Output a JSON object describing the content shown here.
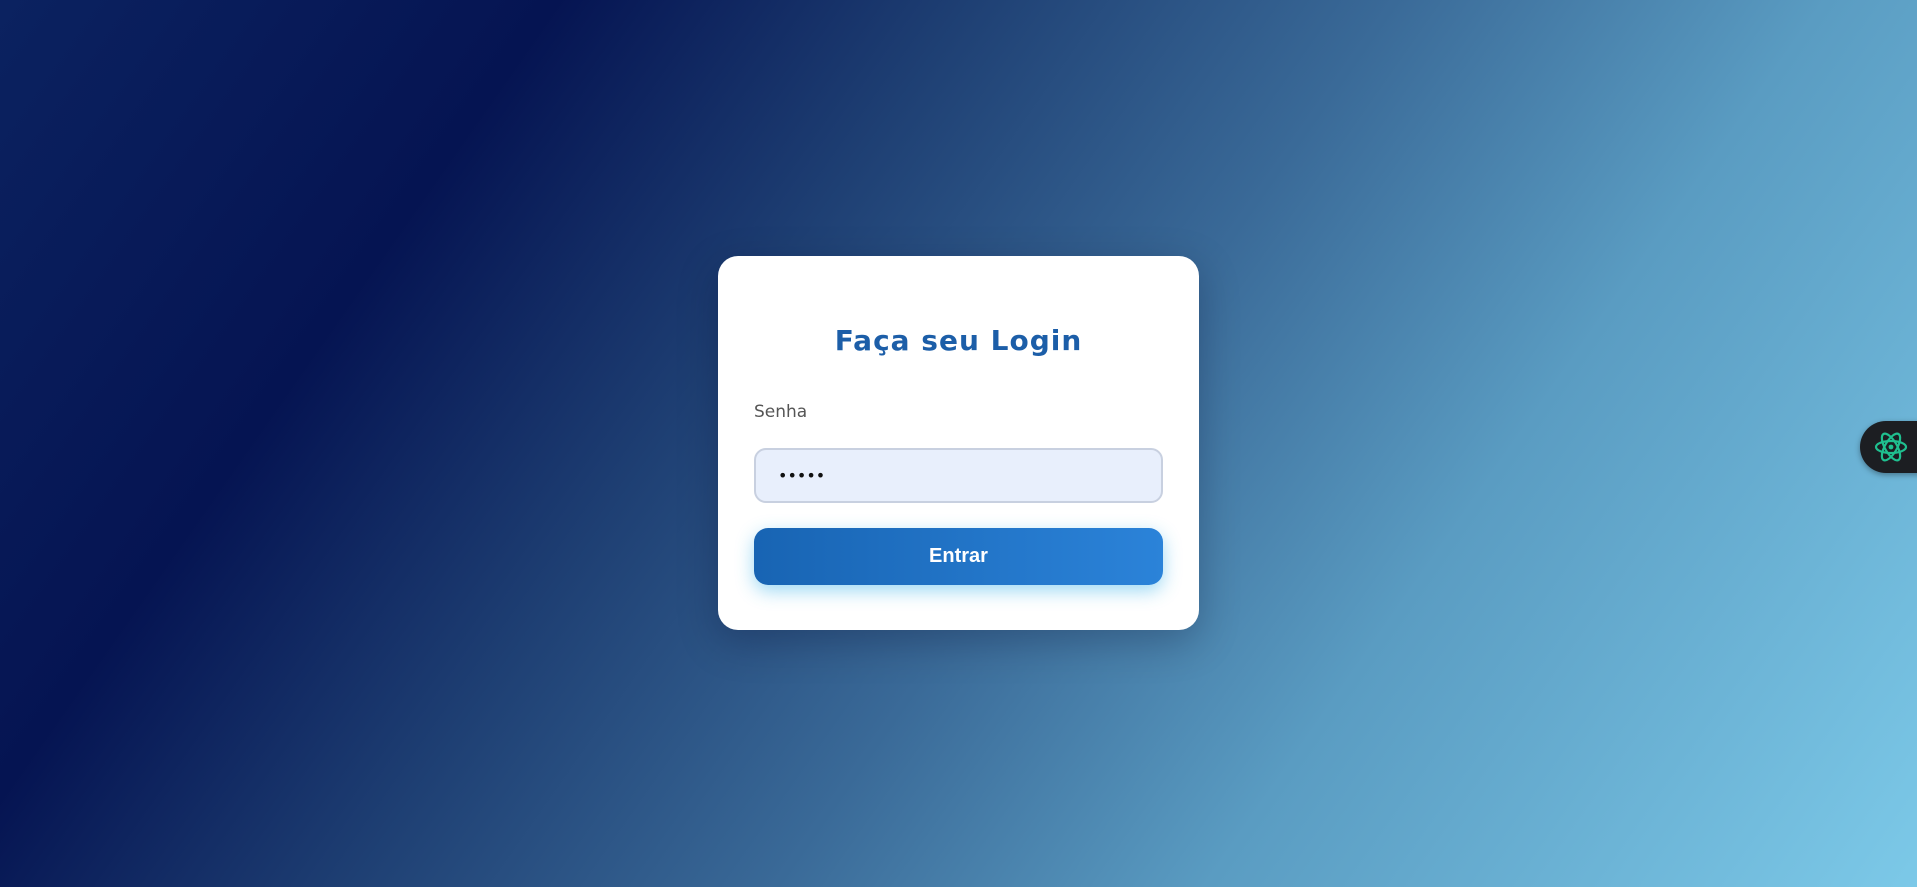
{
  "login": {
    "title": "Faça seu Login",
    "password_label": "Senha",
    "password_value": "•••••",
    "submit_label": "Entrar"
  },
  "colors": {
    "accent": "#1c5ea8",
    "button_start": "#1864b3",
    "button_end": "#2b83d9",
    "widget_icon": "#1fbf8f"
  },
  "icons": {
    "side_widget": "atom-icon"
  }
}
